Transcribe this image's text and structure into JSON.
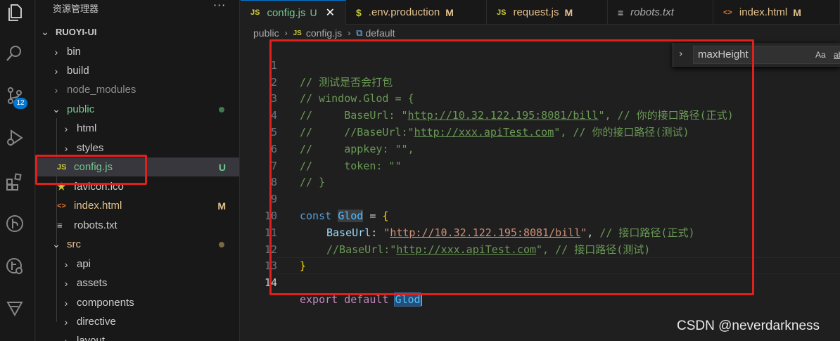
{
  "activity_bar": {
    "icons": [
      "explorer-icon",
      "search-icon",
      "source-control-icon",
      "run-debug-icon",
      "extensions-icon",
      "git-graph-icon",
      "remote-icon",
      "testing-icon"
    ],
    "scm_badge": "12"
  },
  "sidebar": {
    "title": "资源管理器",
    "more": "···",
    "project": "RUOYI-UI",
    "items": [
      {
        "label": "bin"
      },
      {
        "label": "build"
      },
      {
        "label": "node_modules"
      },
      {
        "label": "public"
      },
      {
        "label": "html"
      },
      {
        "label": "styles"
      },
      {
        "label": "config.js",
        "icon": "JS",
        "status": "U"
      },
      {
        "label": "favicon.ico"
      },
      {
        "label": "index.html",
        "icon": "<>",
        "status": "M"
      },
      {
        "label": "robots.txt"
      },
      {
        "label": "src"
      },
      {
        "label": "api"
      },
      {
        "label": "assets"
      },
      {
        "label": "components"
      },
      {
        "label": "directive"
      },
      {
        "label": "layout"
      }
    ]
  },
  "tabs": [
    {
      "icon": "JS",
      "label": "config.js",
      "status": "U",
      "close": "✕"
    },
    {
      "icon": "$",
      "label": ".env.production",
      "status": "M"
    },
    {
      "icon": "JS",
      "label": "request.js",
      "status": "M"
    },
    {
      "icon": "≡",
      "label": "robots.txt"
    },
    {
      "icon": "<>",
      "label": "index.html",
      "status": "M"
    }
  ],
  "breadcrumb": {
    "folder": "public",
    "file_icon": "JS",
    "file": "config.js",
    "symbol": "default"
  },
  "editor": {
    "line_numbers": [
      "1",
      "2",
      "3",
      "4",
      "5",
      "6",
      "7",
      "8",
      "9",
      "10",
      "11",
      "12",
      "13",
      "14"
    ],
    "active_line": "14",
    "l1": "// 测试是否会打包",
    "l2": "// window.Glod = {",
    "l3a": "//     BaseUrl: \"",
    "l3url": "http://10.32.122.195:8081/bill",
    "l3b": "\", // 你的接口路径(正式)",
    "l4a": "//     //BaseUrl:\"",
    "l4url": "http://xxx.apiTest.com",
    "l4b": "\", // 你的接口路径(测试)",
    "l5": "//     appkey: \"\",",
    "l6": "//     token: \"\"",
    "l7": "// }",
    "l9_const": "const",
    "l9_name": "Glod",
    "l9_eq": " = ",
    "l9_brace": "{",
    "l10_prop": "BaseUrl",
    "l10_colon": ": ",
    "l10_q1": "\"",
    "l10_url": "http://10.32.122.195:8081/bill",
    "l10_q2": "\"",
    "l10_comma": ", ",
    "l10_comment": "// 接口路径(正式)",
    "l11a": "//BaseUrl:\"",
    "l11url": "http://xxx.apiTest.com",
    "l11b": "\", // 接口路径(测试)",
    "l12_brace": "}",
    "l14_export": "export",
    "l14_default": "default",
    "l14_name": "Glod"
  },
  "find_widget": {
    "value": "maxHeight",
    "match_case": "Aa",
    "whole_word": "ab"
  },
  "watermark": "CSDN @neverdarkness"
}
